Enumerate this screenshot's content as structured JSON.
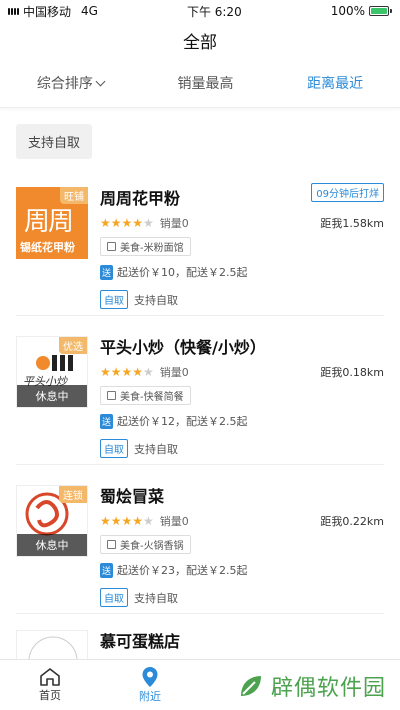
{
  "status_bar": {
    "carrier": "中国移动",
    "network": "4G",
    "time": "下午 6:20",
    "battery": "100%"
  },
  "page": {
    "title": "全部"
  },
  "sort": {
    "items": [
      {
        "label": "综合排序"
      },
      {
        "label": "销量最高"
      },
      {
        "label": "距离最近"
      }
    ]
  },
  "filter": {
    "chip": "支持自取"
  },
  "shops": [
    {
      "name": "周周花甲粉",
      "sales": "销量0",
      "distance": "距我1.58km",
      "category": "美食-米粉面馆",
      "shipping": "起送价￥10，配送￥2.5起",
      "self_pickup": "支持自取",
      "notice": "09分钟后打烊",
      "corner": "旺铺",
      "rating": 4,
      "logo_main": "周周",
      "logo_sub": "锡纸花甲粉"
    },
    {
      "name": "平头小炒（快餐/小炒）",
      "sales": "销量0",
      "distance": "距我0.18km",
      "category": "美食-快餐简餐",
      "shipping": "起送价￥12，配送￥2.5起",
      "self_pickup": "支持自取",
      "corner": "优选",
      "rating": 4,
      "rest": "休息中",
      "logo_text": "平头小炒"
    },
    {
      "name": "蜀烩冒菜",
      "sales": "销量0",
      "distance": "距我0.22km",
      "category": "美食-火锅香锅",
      "shipping": "起送价￥23，配送￥2.5起",
      "self_pickup": "支持自取",
      "corner": "连锁",
      "rating": 4,
      "rest": "休息中"
    },
    {
      "name": "慕可蛋糕店"
    }
  ],
  "labels": {
    "ship_tag": "送",
    "pick_tag": "自取"
  },
  "tabbar": {
    "home": "首页",
    "nearby": "附近"
  },
  "watermark": {
    "text": "辟偶软件园"
  },
  "colors": {
    "accent": "#2b8bd8",
    "star": "#f5a623",
    "logo_orange": "#f08a2c"
  }
}
